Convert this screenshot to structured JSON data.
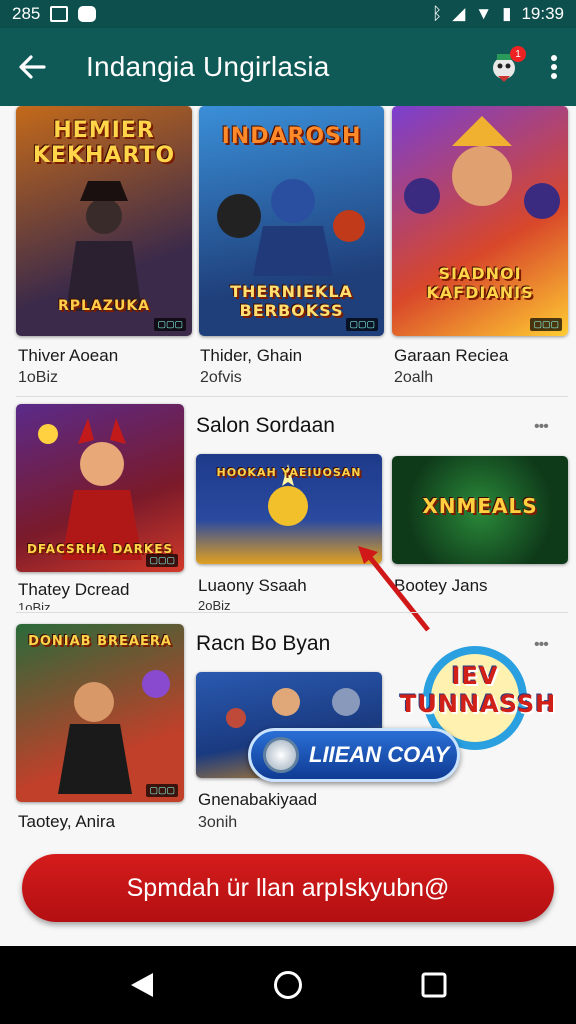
{
  "status": {
    "left_text": "285",
    "time": "19:39"
  },
  "appbar": {
    "title": "Indangia Ungirlasia"
  },
  "row1": [
    {
      "art_title_top": "HEMIER KEKHARTO",
      "art_title_bottom": "RPLAZUKA",
      "label": "Thiver Aoean",
      "sub": "1oBiz",
      "colors": [
        "#c46a1a",
        "#3b2a4a"
      ]
    },
    {
      "art_title_top": "INDAROSH",
      "art_title_bottom": "THERNIEKLA BERBOKSS",
      "label": "Thider, Ghain",
      "sub": "2ofvis",
      "colors": [
        "#3a8fd8",
        "#1f3f7a"
      ]
    },
    {
      "art_title_top": "",
      "art_title_bottom": "SIADNOI KAFDIANIS",
      "label": "Garaan Reciea",
      "sub": "2oalh",
      "colors": [
        "#7a3fd0",
        "#d8472a"
      ]
    }
  ],
  "row2": {
    "left": {
      "art_title": "DFACSRHA DARKES",
      "label": "Thatey Dcread",
      "sub": "1oBiz",
      "colors": [
        "#7a1a2a",
        "#d23a2a"
      ]
    },
    "section_title": "Salon Sordaan",
    "items": [
      {
        "art_title": "HOOKAH YAEIUOSAN",
        "label": "Luaony Ssaah",
        "sub": "2oBiz",
        "colors": [
          "#1e3a8a",
          "#e0a020"
        ]
      },
      {
        "art_title": "XNMEALS",
        "label": "Bootey Jans",
        "sub": "",
        "colors": [
          "#0f5a2a",
          "#5a2a8a"
        ]
      }
    ]
  },
  "row3": {
    "left": {
      "art_title": "DONIAB BREAERA",
      "label": "Taotey, Anira",
      "sub": "",
      "colors": [
        "#2a6a3a",
        "#c0402a"
      ]
    },
    "section_title": "Racn Bo Byan",
    "item": {
      "label": "Gnenabakiyaad",
      "sub": "3onih",
      "colors": [
        "#2a5ab0",
        "#d08a20"
      ]
    },
    "promo_title": "IEV TUNNASSH",
    "pill_text": "LIIEAN COAY"
  },
  "cta": {
    "label": "Spmdah ür llan arpIskyubn@"
  },
  "icons": {
    "back": "arrow-left-icon",
    "notif_badge": "1",
    "menu": "more-vert-icon"
  }
}
